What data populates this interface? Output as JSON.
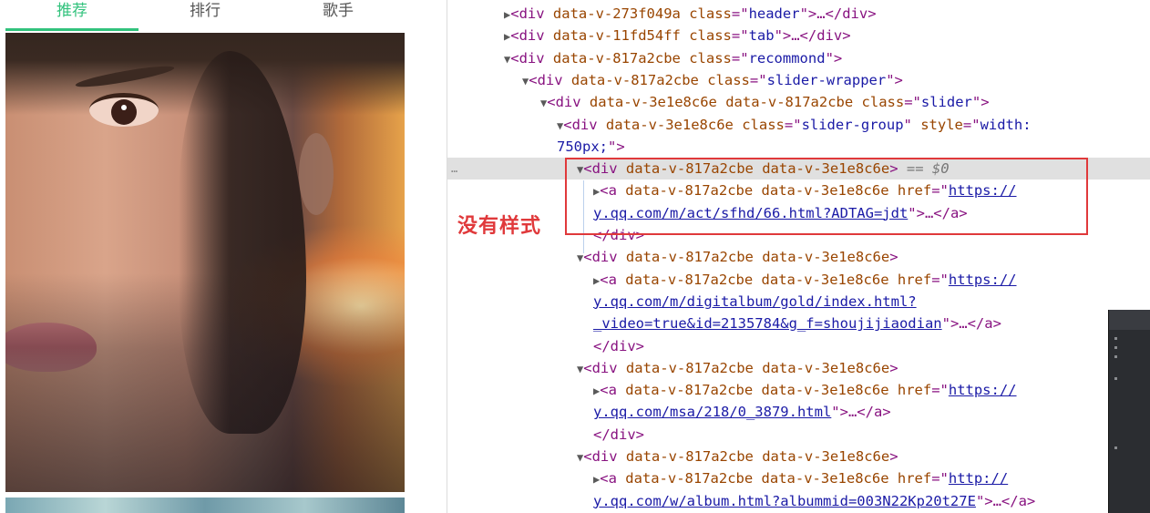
{
  "mobile": {
    "tabs": [
      {
        "label": "推荐",
        "active": true
      },
      {
        "label": "排行",
        "active": false
      },
      {
        "label": "歌手",
        "active": false
      }
    ],
    "accent_color": "#31c27c"
  },
  "devtools": {
    "lines": [
      {
        "open": false,
        "parts": [
          [
            "tag",
            "<div "
          ],
          [
            "attr",
            "data-v-273f049a "
          ],
          [
            "attr",
            "class"
          ],
          [
            "tag",
            "=\""
          ],
          [
            "val",
            "header"
          ],
          [
            "tag",
            "\">…</div>"
          ]
        ]
      },
      {
        "open": false,
        "parts": [
          [
            "tag",
            "<div "
          ],
          [
            "attr",
            "data-v-11fd54ff "
          ],
          [
            "attr",
            "class"
          ],
          [
            "tag",
            "=\""
          ],
          [
            "val",
            "tab"
          ],
          [
            "tag",
            "\">…</div>"
          ]
        ]
      },
      {
        "open": true,
        "parts": [
          [
            "tag",
            "<div "
          ],
          [
            "attr",
            "data-v-817a2cbe "
          ],
          [
            "attr",
            "class"
          ],
          [
            "tag",
            "=\""
          ],
          [
            "val",
            "recommond"
          ],
          [
            "tag",
            "\">"
          ]
        ]
      },
      {
        "open": true,
        "parts": [
          [
            "tag",
            "<div "
          ],
          [
            "attr",
            "data-v-817a2cbe "
          ],
          [
            "attr",
            "class"
          ],
          [
            "tag",
            "=\""
          ],
          [
            "val",
            "slider-wrapper"
          ],
          [
            "tag",
            "\">"
          ]
        ]
      },
      {
        "open": true,
        "parts": [
          [
            "tag",
            "<div "
          ],
          [
            "attr",
            "data-v-3e1e8c6e data-v-817a2cbe "
          ],
          [
            "attr",
            "class"
          ],
          [
            "tag",
            "=\""
          ],
          [
            "val",
            "slider"
          ],
          [
            "tag",
            "\">"
          ]
        ]
      },
      {
        "open": true,
        "parts": [
          [
            "tag",
            "<div "
          ],
          [
            "attr",
            "data-v-3e1e8c6e "
          ],
          [
            "attr",
            "class"
          ],
          [
            "tag",
            "=\""
          ],
          [
            "val",
            "slider-group"
          ],
          [
            "tag",
            "\" "
          ],
          [
            "attr",
            "style"
          ],
          [
            "tag",
            "=\""
          ],
          [
            "val",
            "width:"
          ]
        ]
      },
      {
        "cont": true,
        "parts": [
          [
            "val",
            "750px;"
          ],
          [
            "tag",
            "\">"
          ]
        ]
      },
      {
        "open": true,
        "selected": true,
        "parts": [
          [
            "tag",
            "<div "
          ],
          [
            "attr",
            "data-v-817a2cbe data-v-3e1e8c6e"
          ],
          [
            "tag",
            ">"
          ],
          [
            "eq",
            " == $0"
          ]
        ]
      },
      {
        "open": false,
        "parts": [
          [
            "tag",
            "<a "
          ],
          [
            "attr",
            "data-v-817a2cbe data-v-3e1e8c6e "
          ],
          [
            "attr",
            "href"
          ],
          [
            "tag",
            "=\""
          ],
          [
            "link",
            "https://"
          ]
        ]
      },
      {
        "cont": true,
        "parts": [
          [
            "link",
            "y.qq.com/m/act/sfhd/66.html?ADTAG=jdt"
          ],
          [
            "tag",
            "\">…</a>"
          ]
        ]
      },
      {
        "cont": true,
        "parts": [
          [
            "tag",
            "</div>"
          ]
        ]
      },
      {
        "open": true,
        "parts": [
          [
            "tag",
            "<div "
          ],
          [
            "attr",
            "data-v-817a2cbe data-v-3e1e8c6e"
          ],
          [
            "tag",
            ">"
          ]
        ]
      },
      {
        "open": false,
        "parts": [
          [
            "tag",
            "<a "
          ],
          [
            "attr",
            "data-v-817a2cbe data-v-3e1e8c6e "
          ],
          [
            "attr",
            "href"
          ],
          [
            "tag",
            "=\""
          ],
          [
            "link",
            "https://"
          ]
        ]
      },
      {
        "cont": true,
        "parts": [
          [
            "link",
            "y.qq.com/m/digitalbum/gold/index.html?"
          ]
        ]
      },
      {
        "cont": true,
        "parts": [
          [
            "link",
            "_video=true&id=2135784&g_f=shoujijiaodian"
          ],
          [
            "tag",
            "\">…</a>"
          ]
        ]
      },
      {
        "cont": true,
        "parts": [
          [
            "tag",
            "</div>"
          ]
        ]
      },
      {
        "open": true,
        "parts": [
          [
            "tag",
            "<div "
          ],
          [
            "attr",
            "data-v-817a2cbe data-v-3e1e8c6e"
          ],
          [
            "tag",
            ">"
          ]
        ]
      },
      {
        "open": false,
        "parts": [
          [
            "tag",
            "<a "
          ],
          [
            "attr",
            "data-v-817a2cbe data-v-3e1e8c6e "
          ],
          [
            "attr",
            "href"
          ],
          [
            "tag",
            "=\""
          ],
          [
            "link",
            "https://"
          ]
        ]
      },
      {
        "cont": true,
        "parts": [
          [
            "link",
            "y.qq.com/msa/218/0_3879.html"
          ],
          [
            "tag",
            "\">…</a>"
          ]
        ]
      },
      {
        "cont": true,
        "parts": [
          [
            "tag",
            "</div>"
          ]
        ]
      },
      {
        "open": true,
        "parts": [
          [
            "tag",
            "<div "
          ],
          [
            "attr",
            "data-v-817a2cbe data-v-3e1e8c6e"
          ],
          [
            "tag",
            ">"
          ]
        ]
      },
      {
        "open": false,
        "parts": [
          [
            "tag",
            "<a "
          ],
          [
            "attr",
            "data-v-817a2cbe data-v-3e1e8c6e "
          ],
          [
            "attr",
            "href"
          ],
          [
            "tag",
            "=\""
          ],
          [
            "link",
            "http://"
          ]
        ]
      },
      {
        "cont": true,
        "parts": [
          [
            "link",
            "y.qq.com/w/album.html?albummid=003N22Kp20t27E"
          ],
          [
            "tag",
            "\">…</a>"
          ]
        ]
      }
    ],
    "selected_dots": "…"
  },
  "annotation": {
    "note": "没有样式",
    "color": "#e0393b"
  }
}
